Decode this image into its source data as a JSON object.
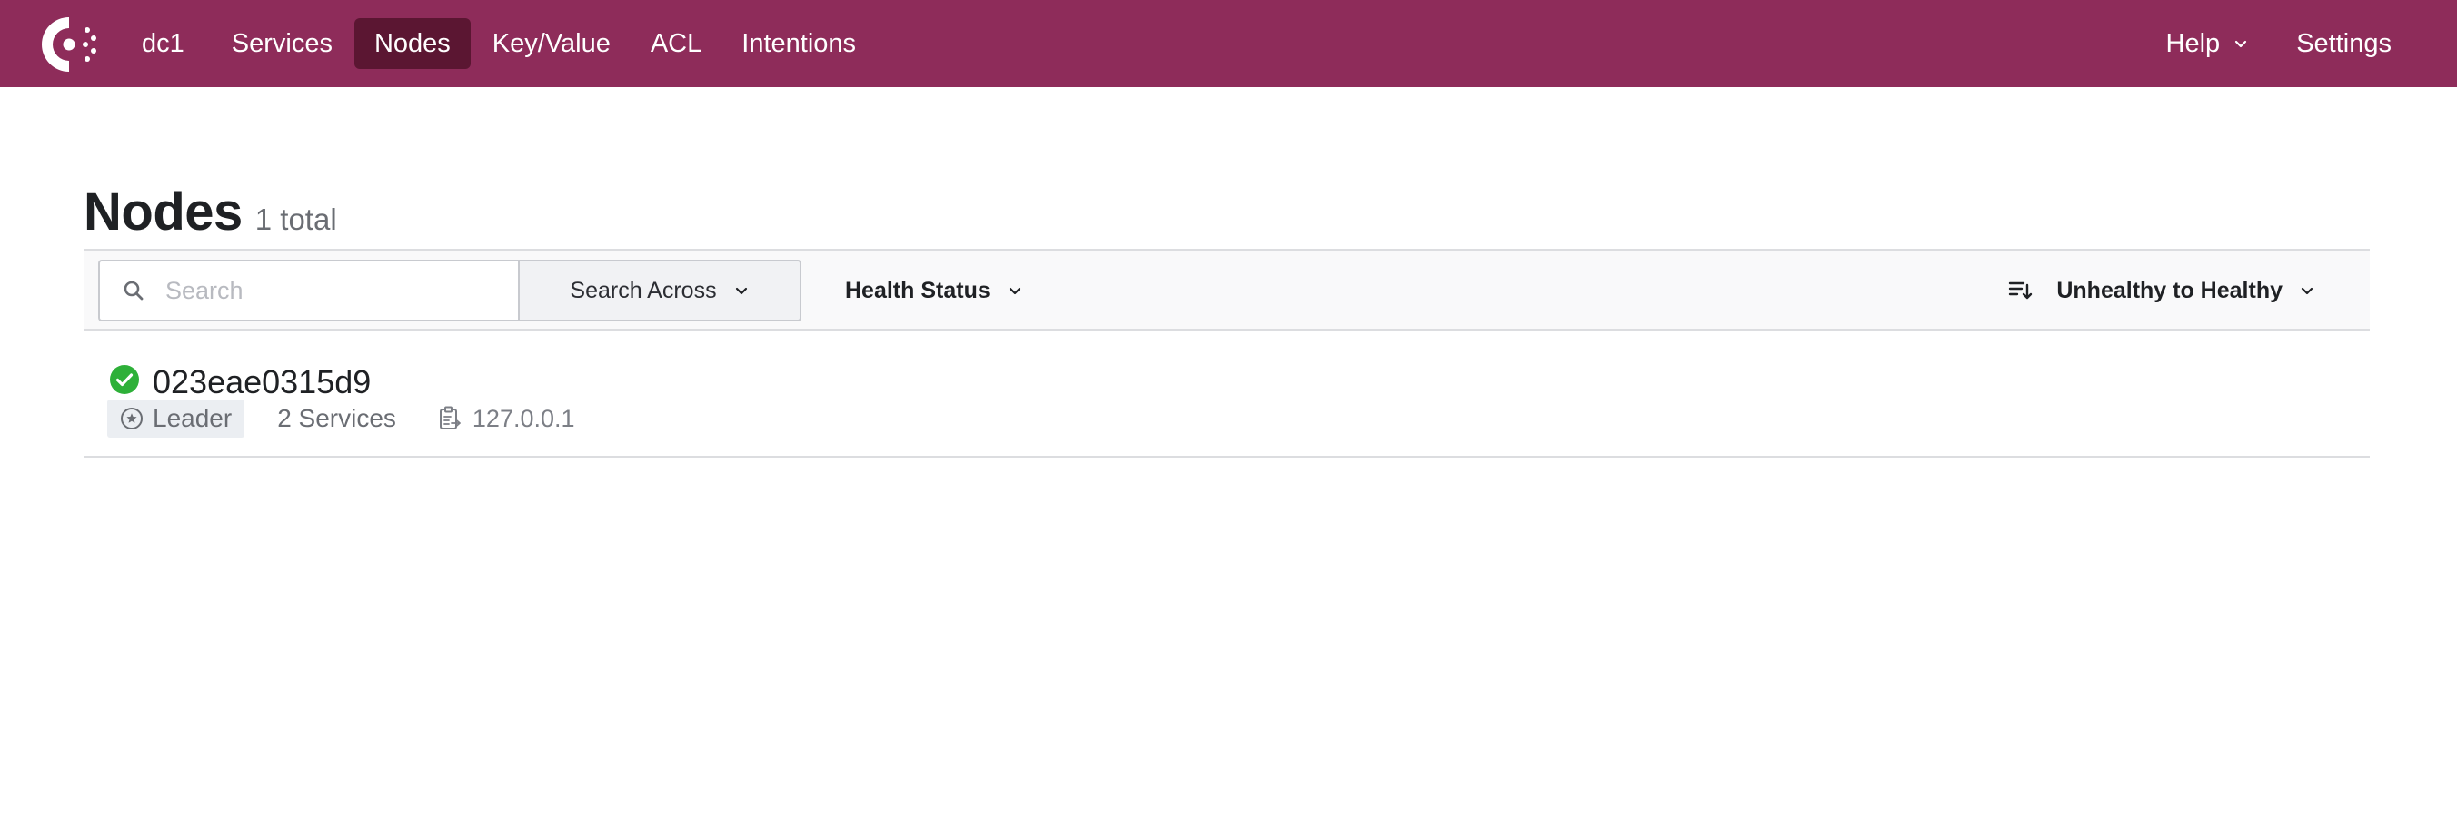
{
  "colors": {
    "brand": "#8e2c5a",
    "brand_active": "#5b1632",
    "healthy": "#2eb039"
  },
  "nav": {
    "logo_icon": "consul-logo-icon",
    "datacenter": "dc1",
    "items": [
      "Services",
      "Nodes",
      "Key/Value",
      "ACL",
      "Intentions"
    ],
    "active": "Nodes",
    "help_label": "Help",
    "settings_label": "Settings"
  },
  "page": {
    "title": "Nodes",
    "count": "1 total"
  },
  "filters": {
    "search_placeholder": "Search",
    "search_value": "",
    "search_across_label": "Search Across",
    "health_status_label": "Health Status",
    "sort_label": "Unhealthy to Healthy"
  },
  "nodes": [
    {
      "name": "023eae0315d9",
      "health": "passing",
      "health_icon": "check-circle-icon",
      "badge": "Leader",
      "services": "2 Services",
      "address": "127.0.0.1"
    }
  ]
}
